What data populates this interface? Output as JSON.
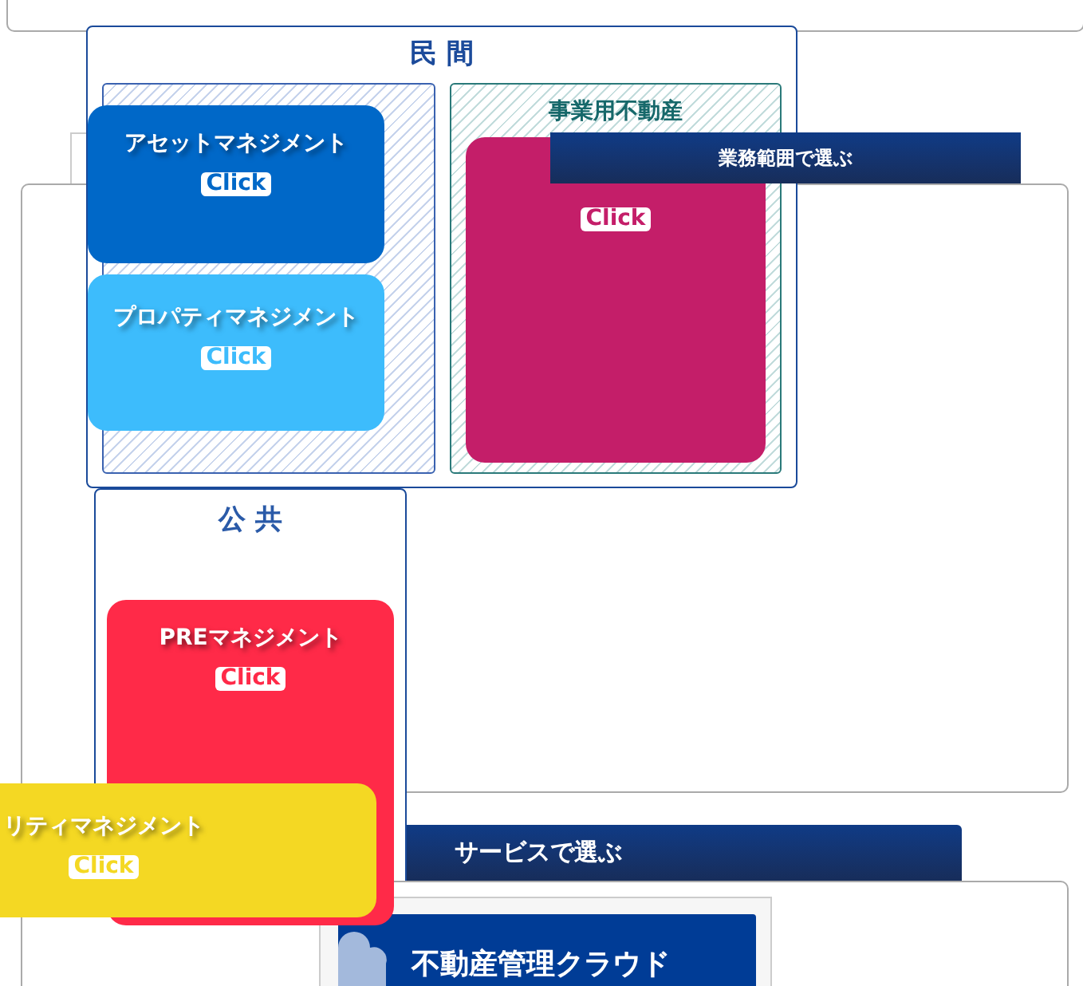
{
  "private_panel": {
    "title": "民 間",
    "sections": [
      {
        "kind": "investment"
      },
      {
        "kind": "business",
        "title": "事業用不動産"
      }
    ]
  },
  "tabs": [
    {
      "label": "業務範囲で選ぶ"
    },
    {
      "label": "サービスで選ぶ"
    }
  ],
  "cards": [
    {
      "kind": "asset",
      "title": "アセットマネジメント",
      "button": "Click",
      "color": "#0068c8"
    },
    {
      "kind": "property",
      "title": "プロパティマネジメント",
      "button": "Click",
      "color": "#3dbcfc"
    },
    {
      "kind": "cre",
      "button": "Click",
      "color": "#c41e69"
    },
    {
      "kind": "pre",
      "title": "PREマネジメント",
      "button": "Click",
      "color": "#ff2a48"
    },
    {
      "kind": "facility",
      "title": "リティマネジメント",
      "button": "Click",
      "color": "#f4d823"
    }
  ],
  "public_panel": {
    "title": "公 共"
  },
  "banner": {
    "title": "不動産管理クラウド"
  }
}
